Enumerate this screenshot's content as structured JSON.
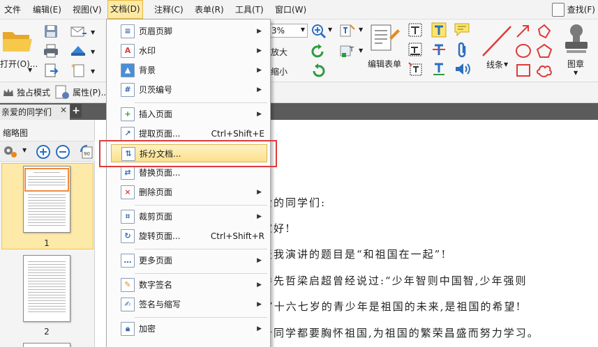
{
  "menubar": {
    "items": [
      {
        "label": "文件"
      },
      {
        "label": "编辑(E)"
      },
      {
        "label": "视图(V)"
      },
      {
        "label": "文档(D)"
      },
      {
        "label": "注释(C)"
      },
      {
        "label": "表单(R)"
      },
      {
        "label": "工具(T)"
      },
      {
        "label": "窗口(W)"
      }
    ],
    "find_label": "查找(F)"
  },
  "ribbon": {
    "open_label": "打开(O)...",
    "zoom_value": "3%",
    "zoom_in_label": "放大",
    "zoom_out_label": "缩小",
    "edit_form_label": "编辑表单",
    "lines_label": "线条",
    "stamp_label": "图章"
  },
  "modebar": {
    "exclusive_label": "独占模式",
    "properties_label": "属性(P)..."
  },
  "tabbar": {
    "doc_tab": "亲爱的同学们"
  },
  "sidebar": {
    "title": "缩略图",
    "pages": [
      "1",
      "2"
    ]
  },
  "document": {
    "lines": [
      "爱的同学们:",
      "家好!",
      "天我演讲的题目是“和祖国在一起”!",
      "爵先哲梁启超曾经说过:“少年智则中国智,少年强则",
      "!”十六七岁的青少年是祖国的未来,是祖国的希望!",
      "个同学都要胸怀祖国,为祖国的繁荣昌盛而努力学习。"
    ]
  },
  "dropdown": {
    "items": [
      {
        "label": "页眉页脚",
        "shortcut": "",
        "submenu": true
      },
      {
        "label": "水印",
        "shortcut": "",
        "submenu": true
      },
      {
        "label": "背景",
        "shortcut": "",
        "submenu": true
      },
      {
        "label": "贝茨编号",
        "shortcut": "",
        "submenu": true
      },
      {
        "label": "插入页面",
        "shortcut": "",
        "submenu": true
      },
      {
        "label": "提取页面...",
        "shortcut": "Ctrl+Shift+E",
        "submenu": false
      },
      {
        "label": "拆分文档...",
        "shortcut": "",
        "submenu": false,
        "highlighted": true
      },
      {
        "label": "替换页面...",
        "shortcut": "",
        "submenu": false
      },
      {
        "label": "删除页面",
        "shortcut": "",
        "submenu": true
      },
      {
        "label": "裁剪页面",
        "shortcut": "",
        "submenu": true
      },
      {
        "label": "旋转页面...",
        "shortcut": "Ctrl+Shift+R",
        "submenu": false
      },
      {
        "label": "更多页面",
        "shortcut": "",
        "submenu": true
      },
      {
        "label": "数字签名",
        "shortcut": "",
        "submenu": true
      },
      {
        "label": "签名与缩写",
        "shortcut": "",
        "submenu": true
      },
      {
        "label": "加密",
        "shortcut": "",
        "submenu": true
      }
    ]
  },
  "colors": {
    "menu_active_bg": "#fce9a6",
    "highlight_border": "#e03a3a",
    "thumb_selected_bg": "#fde9a8"
  }
}
